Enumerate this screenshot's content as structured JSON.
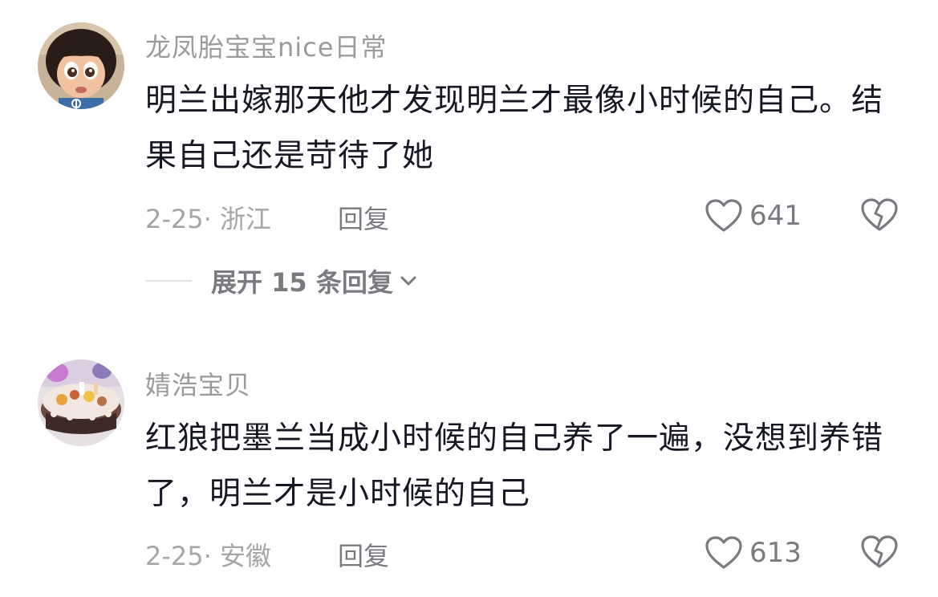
{
  "comments": [
    {
      "avatar_icon": "cartoon-girl-avatar",
      "username": "龙凤胎宝宝nice日常",
      "text": "明兰出嫁那天他才发现明兰才最像小时候的自己。结果自己还是苛待了她",
      "meta": "2-25· 浙江",
      "reply_label": "回复",
      "like_count": "641",
      "expand_label": "展开 15 条回复"
    },
    {
      "avatar_icon": "birthday-cake-avatar",
      "username": "婧浩宝贝",
      "text": "红狼把墨兰当成小时候的自己养了一遍，没想到养错了，明兰才是小时候的自己",
      "meta": "2-25· 安徽",
      "reply_label": "回复",
      "like_count": "613"
    }
  ],
  "icons": {
    "like": "heart-outline-icon",
    "dislike": "broken-heart-icon",
    "expand": "chevron-down-icon"
  },
  "colors": {
    "text_primary": "#161823",
    "text_secondary": "#9b9b9f",
    "icon_gray": "#7a7b80"
  }
}
